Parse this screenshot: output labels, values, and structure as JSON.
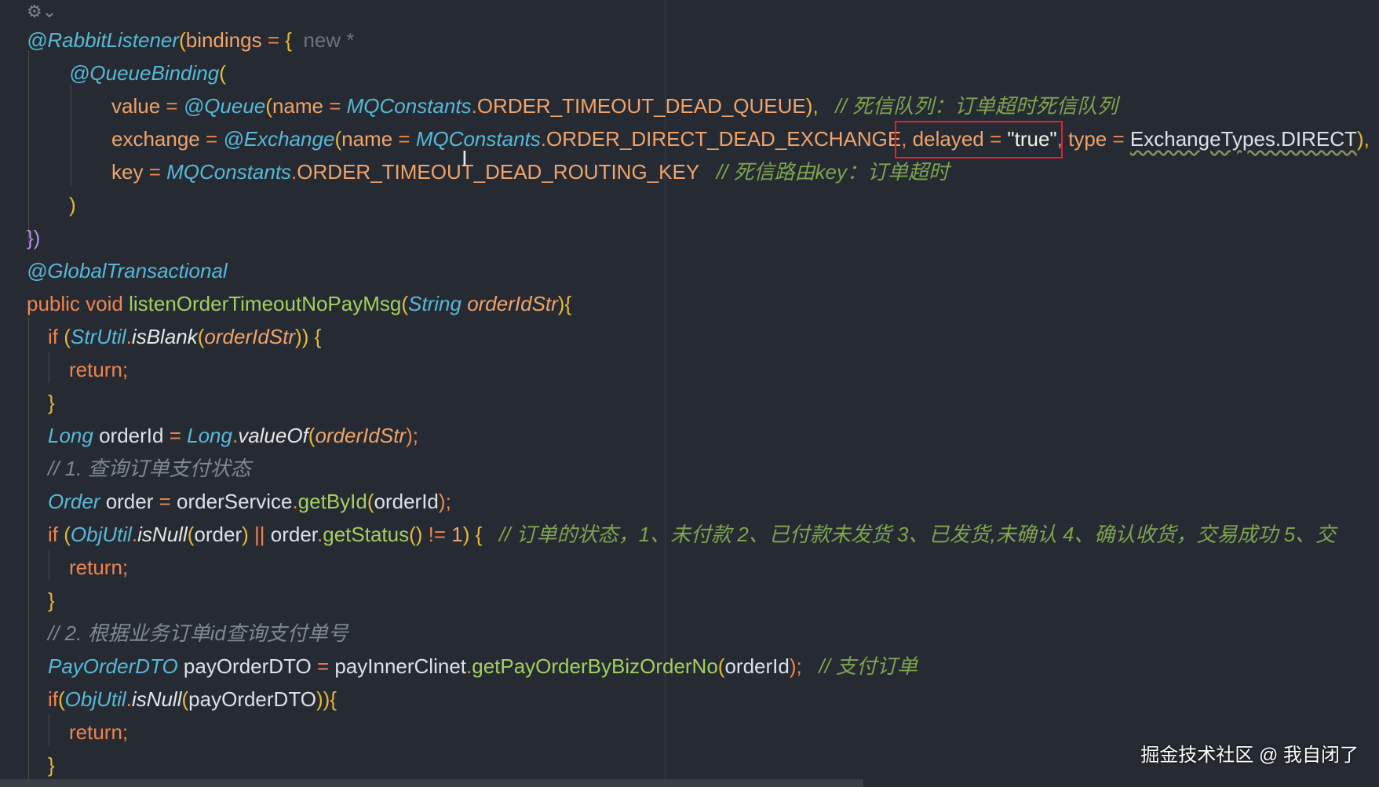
{
  "editor": {
    "gutter_icon": "file-type-icon",
    "cursor_icon": "text-cursor-icon",
    "lines": [
      {
        "indent": 0,
        "tokens": [
          {
            "t": "@RabbitListener",
            "c": "ann"
          },
          {
            "t": "(",
            "c": "par"
          },
          {
            "t": "bindings",
            "c": "cst"
          },
          {
            "t": " = ",
            "c": "op"
          },
          {
            "t": "{",
            "c": "par"
          },
          {
            "t": "  new *",
            "c": "hint"
          }
        ]
      },
      {
        "indent": 1,
        "tokens": [
          {
            "t": "@QueueBinding",
            "c": "ann"
          },
          {
            "t": "(",
            "c": "par"
          }
        ]
      },
      {
        "indent": 2,
        "tokens": [
          {
            "t": "value",
            "c": "cst"
          },
          {
            "t": " = ",
            "c": "op"
          },
          {
            "t": "@Queue",
            "c": "ann"
          },
          {
            "t": "(",
            "c": "par"
          },
          {
            "t": "name",
            "c": "cst"
          },
          {
            "t": " = ",
            "c": "op"
          },
          {
            "t": "MQConstants",
            "c": "cls"
          },
          {
            "t": ".",
            "c": "op"
          },
          {
            "t": "ORDER_TIMEOUT_DEAD_QUEUE",
            "c": "cst"
          },
          {
            "t": "),",
            "c": "par"
          },
          {
            "t": "   // 死信队列：订单超时死信队列",
            "c": "cmt"
          }
        ]
      },
      {
        "indent": 2,
        "tokens": [
          {
            "t": "exchange",
            "c": "cst"
          },
          {
            "t": " = ",
            "c": "op"
          },
          {
            "t": "@Exchange",
            "c": "ann"
          },
          {
            "t": "(",
            "c": "par"
          },
          {
            "t": "name",
            "c": "cst"
          },
          {
            "t": " = ",
            "c": "op"
          },
          {
            "t": "MQConstants",
            "c": "cls"
          },
          {
            "t": ".",
            "c": "op"
          },
          {
            "t": "ORDER_DIRECT_DEAD_EXCHANGE",
            "c": "cst"
          },
          {
            "t": ", ",
            "c": "op"
          },
          {
            "t": "delayed",
            "c": "cst"
          },
          {
            "t": " = ",
            "c": "op"
          },
          {
            "t": "\"true\"",
            "c": "str"
          },
          {
            "t": ", ",
            "c": "op"
          },
          {
            "t": "type",
            "c": "cst"
          },
          {
            "t": " = ",
            "c": "op"
          },
          {
            "t": "ExchangeTypes.DIRECT",
            "c": "gcmt-sq"
          },
          {
            "t": "),",
            "c": "par"
          },
          {
            "t": "   ,",
            "c": "op"
          }
        ]
      },
      {
        "indent": 2,
        "tokens": [
          {
            "t": "key",
            "c": "cst"
          },
          {
            "t": " = ",
            "c": "op"
          },
          {
            "t": "MQConstants",
            "c": "cls"
          },
          {
            "t": ".",
            "c": "op"
          },
          {
            "t": "ORDER_TIMEOUT_DEAD_ROUTING_KEY",
            "c": "cst"
          },
          {
            "t": "   // 死信路由key：订单超时",
            "c": "cmt"
          }
        ]
      },
      {
        "indent": 1,
        "tokens": [
          {
            "t": ")",
            "c": "par"
          }
        ]
      },
      {
        "indent": 0,
        "tokens": [
          {
            "t": "})",
            "c": "brk2"
          }
        ]
      },
      {
        "indent": 0,
        "tokens": [
          {
            "t": "@GlobalTransactional",
            "c": "ann"
          }
        ]
      },
      {
        "indent": 0,
        "tokens": [
          {
            "t": "public void ",
            "c": "kw"
          },
          {
            "t": "listenOrderTimeoutNoPayMsg",
            "c": "meth"
          },
          {
            "t": "(",
            "c": "par"
          },
          {
            "t": "String ",
            "c": "cls"
          },
          {
            "t": "orderIdStr",
            "c": "param"
          },
          {
            "t": "){",
            "c": "par"
          }
        ]
      },
      {
        "indent": 0.5,
        "tokens": [
          {
            "t": "if ",
            "c": "kw"
          },
          {
            "t": "(",
            "c": "par"
          },
          {
            "t": "StrUtil",
            "c": "cls"
          },
          {
            "t": ".",
            "c": "op"
          },
          {
            "t": "isBlank",
            "c": "smeth"
          },
          {
            "t": "(",
            "c": "par"
          },
          {
            "t": "orderIdStr",
            "c": "param"
          },
          {
            "t": ")) {",
            "c": "par"
          }
        ]
      },
      {
        "indent": 1,
        "tokens": [
          {
            "t": "return",
            "c": "kw"
          },
          {
            "t": ";",
            "c": "op"
          }
        ]
      },
      {
        "indent": 0.5,
        "tokens": [
          {
            "t": "}",
            "c": "par"
          }
        ]
      },
      {
        "indent": 0.5,
        "tokens": [
          {
            "t": "Long ",
            "c": "cls"
          },
          {
            "t": "orderId",
            "c": "plain"
          },
          {
            "t": " = ",
            "c": "op"
          },
          {
            "t": "Long",
            "c": "cls"
          },
          {
            "t": ".",
            "c": "op"
          },
          {
            "t": "valueOf",
            "c": "smeth"
          },
          {
            "t": "(",
            "c": "par"
          },
          {
            "t": "orderIdStr",
            "c": "param"
          },
          {
            "t": ");",
            "c": "op"
          }
        ]
      },
      {
        "indent": 0.5,
        "tokens": [
          {
            "t": "// 1. 查询订单支付状态",
            "c": "gcmt"
          }
        ]
      },
      {
        "indent": 0.5,
        "tokens": [
          {
            "t": "Order ",
            "c": "cls"
          },
          {
            "t": "order",
            "c": "plain"
          },
          {
            "t": " = ",
            "c": "op"
          },
          {
            "t": "orderService",
            "c": "plain"
          },
          {
            "t": ".",
            "c": "op"
          },
          {
            "t": "getById",
            "c": "meth"
          },
          {
            "t": "(",
            "c": "par"
          },
          {
            "t": "orderId",
            "c": "plain"
          },
          {
            "t": ");",
            "c": "op"
          }
        ]
      },
      {
        "indent": 0.5,
        "tokens": [
          {
            "t": "if ",
            "c": "kw"
          },
          {
            "t": "(",
            "c": "par"
          },
          {
            "t": "ObjUtil",
            "c": "cls"
          },
          {
            "t": ".",
            "c": "op"
          },
          {
            "t": "isNull",
            "c": "smeth"
          },
          {
            "t": "(",
            "c": "par"
          },
          {
            "t": "order",
            "c": "plain"
          },
          {
            "t": ") ",
            "c": "par"
          },
          {
            "t": "|| ",
            "c": "op"
          },
          {
            "t": "order",
            "c": "plain"
          },
          {
            "t": ".",
            "c": "op"
          },
          {
            "t": "getStatus",
            "c": "meth"
          },
          {
            "t": "() ",
            "c": "par"
          },
          {
            "t": "!= ",
            "c": "op"
          },
          {
            "t": "1",
            "c": "cst"
          },
          {
            "t": ") {",
            "c": "par"
          },
          {
            "t": "   // 订单的状态，1、未付款 2、已付款未发货 3、已发货,未确认 4、确认收货，交易成功 5、交",
            "c": "cmt"
          }
        ]
      },
      {
        "indent": 1,
        "tokens": [
          {
            "t": "return",
            "c": "kw"
          },
          {
            "t": ";",
            "c": "op"
          }
        ]
      },
      {
        "indent": 0.5,
        "tokens": [
          {
            "t": "}",
            "c": "par"
          }
        ]
      },
      {
        "indent": 0.5,
        "tokens": [
          {
            "t": "// 2. 根据业务订单id查询支付单号",
            "c": "gcmt"
          }
        ]
      },
      {
        "indent": 0.5,
        "tokens": [
          {
            "t": "PayOrderDTO ",
            "c": "cls"
          },
          {
            "t": "payOrderDTO",
            "c": "plain"
          },
          {
            "t": " = ",
            "c": "op"
          },
          {
            "t": "payInnerClinet",
            "c": "plain"
          },
          {
            "t": ".",
            "c": "op"
          },
          {
            "t": "getPayOrderByBizOrderNo",
            "c": "meth"
          },
          {
            "t": "(",
            "c": "par"
          },
          {
            "t": "orderId",
            "c": "plain"
          },
          {
            "t": ");",
            "c": "op"
          },
          {
            "t": "   // 支付订单",
            "c": "cmt"
          }
        ]
      },
      {
        "indent": 0.5,
        "tokens": [
          {
            "t": "if",
            "c": "kw"
          },
          {
            "t": "(",
            "c": "par"
          },
          {
            "t": "ObjUtil",
            "c": "cls"
          },
          {
            "t": ".",
            "c": "op"
          },
          {
            "t": "isNull",
            "c": "smeth"
          },
          {
            "t": "(",
            "c": "par"
          },
          {
            "t": "payOrderDTO",
            "c": "plain"
          },
          {
            "t": ")){",
            "c": "par"
          }
        ]
      },
      {
        "indent": 1,
        "tokens": [
          {
            "t": "return",
            "c": "kw"
          },
          {
            "t": ";",
            "c": "op"
          }
        ]
      },
      {
        "indent": 0.5,
        "tokens": [
          {
            "t": "}",
            "c": "par"
          }
        ]
      }
    ]
  },
  "watermark": "掘金技术社区 @ 我自闭了"
}
